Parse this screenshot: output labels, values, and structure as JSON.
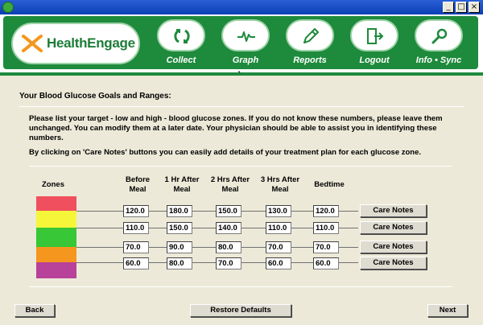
{
  "app": {
    "name": "HealthEngage"
  },
  "nav": [
    {
      "id": "collect",
      "label": "Collect",
      "icon": "refresh-icon"
    },
    {
      "id": "graph",
      "label": "Graph",
      "icon": "heartbeat-icon"
    },
    {
      "id": "reports",
      "label": "Reports",
      "icon": "pencil-icon"
    },
    {
      "id": "logout",
      "label": "Logout",
      "icon": "exit-door-icon"
    },
    {
      "id": "info",
      "label": "Info • Sync",
      "icon": "magnifier-icon"
    }
  ],
  "section_title": "Your Blood Glucose Goals and Ranges:",
  "instructions": [
    "Please list your target - low and high - blood glucose zones. If you do not know these numbers, please leave them unchanged. You can modify them at a later date. Your physician should be able to assist you in identifying these numbers.",
    "By clicking on 'Care Notes' buttons you can easily add details of your treatment plan for each glucose zone."
  ],
  "table": {
    "zones_label": "Zones",
    "columns": [
      {
        "line1": "Before",
        "line2": "Meal"
      },
      {
        "line1": "1 Hr After",
        "line2": "Meal"
      },
      {
        "line1": "2 Hrs After",
        "line2": "Meal"
      },
      {
        "line1": "3 Hrs After",
        "line2": "Meal"
      },
      {
        "line1": "Bedtime",
        "line2": ""
      }
    ],
    "rows": [
      [
        "120.0",
        "180.0",
        "150.0",
        "130.0",
        "120.0"
      ],
      [
        "110.0",
        "150.0",
        "140.0",
        "110.0",
        "110.0"
      ],
      [
        "70.0",
        "90.0",
        "80.0",
        "70.0",
        "70.0"
      ],
      [
        "60.0",
        "80.0",
        "70.0",
        "60.0",
        "60.0"
      ]
    ],
    "care_notes_label": "Care Notes",
    "zone_colors": [
      "#f0505e",
      "#f5f53a",
      "#37c737",
      "#f5961e",
      "#b8419a"
    ]
  },
  "footer": {
    "back_label": "Back",
    "restore_label": "Restore Defaults",
    "next_label": "Next"
  }
}
